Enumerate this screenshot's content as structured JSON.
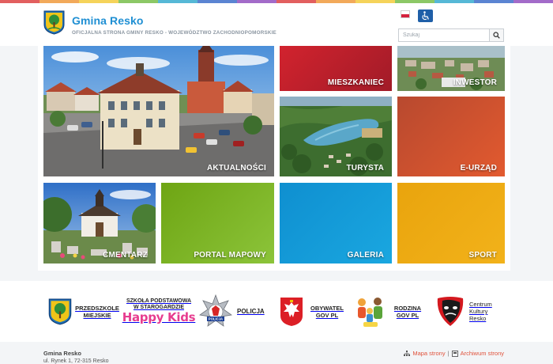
{
  "header": {
    "title": "Gmina Resko",
    "subtitle": "OFICJALNA STRONA GMINY RESKO - WOJEWÓDZTWO ZACHODNIOPOMORSKIE",
    "search_placeholder": "Szukaj"
  },
  "colors": {
    "brand_blue": "#1f8fd3",
    "accent_red": "#e0533c",
    "stripe": [
      "#e25f5f",
      "#f2a95a",
      "#f5d35a",
      "#8cc866",
      "#56b8d6",
      "#5b84d2",
      "#a36bc9",
      "#e25f5f",
      "#f2a95a",
      "#f5d35a",
      "#8cc866",
      "#56b8d6",
      "#5b84d2",
      "#a36bc9"
    ]
  },
  "tiles": [
    {
      "label": "AKTUALNOŚCI"
    },
    {
      "label": "MIESZKANIEC"
    },
    {
      "label": "INWESTOR"
    },
    {
      "label": "TURYSTA"
    },
    {
      "label": "E-URZĄD"
    },
    {
      "label": "CMENTARZ"
    },
    {
      "label": "PORTAL MAPOWY"
    },
    {
      "label": "GALERIA"
    },
    {
      "label": "SPORT"
    }
  ],
  "partners": {
    "przedszkole": "PRZEDSZKOLE MIEJSKIE",
    "szkola_line1": "SZKOŁA PODSTAWOWA",
    "szkola_line2": "W STAROGARDZIE",
    "happy_kids": "Happy Kids",
    "policja_badge": "POLICJA",
    "policja": "POLICJA",
    "obywatel": "OBYWATEL GOV PL",
    "rodzina": "RODZINA GOV PL",
    "centrum": "Centrum Kultury Resko"
  },
  "footer": {
    "name": "Gmina Resko",
    "address": "ul. Rynek 1, 72-315 Resko",
    "sitemap": "Mapa strony",
    "separator": "|",
    "archive": "Archiwum strony"
  }
}
